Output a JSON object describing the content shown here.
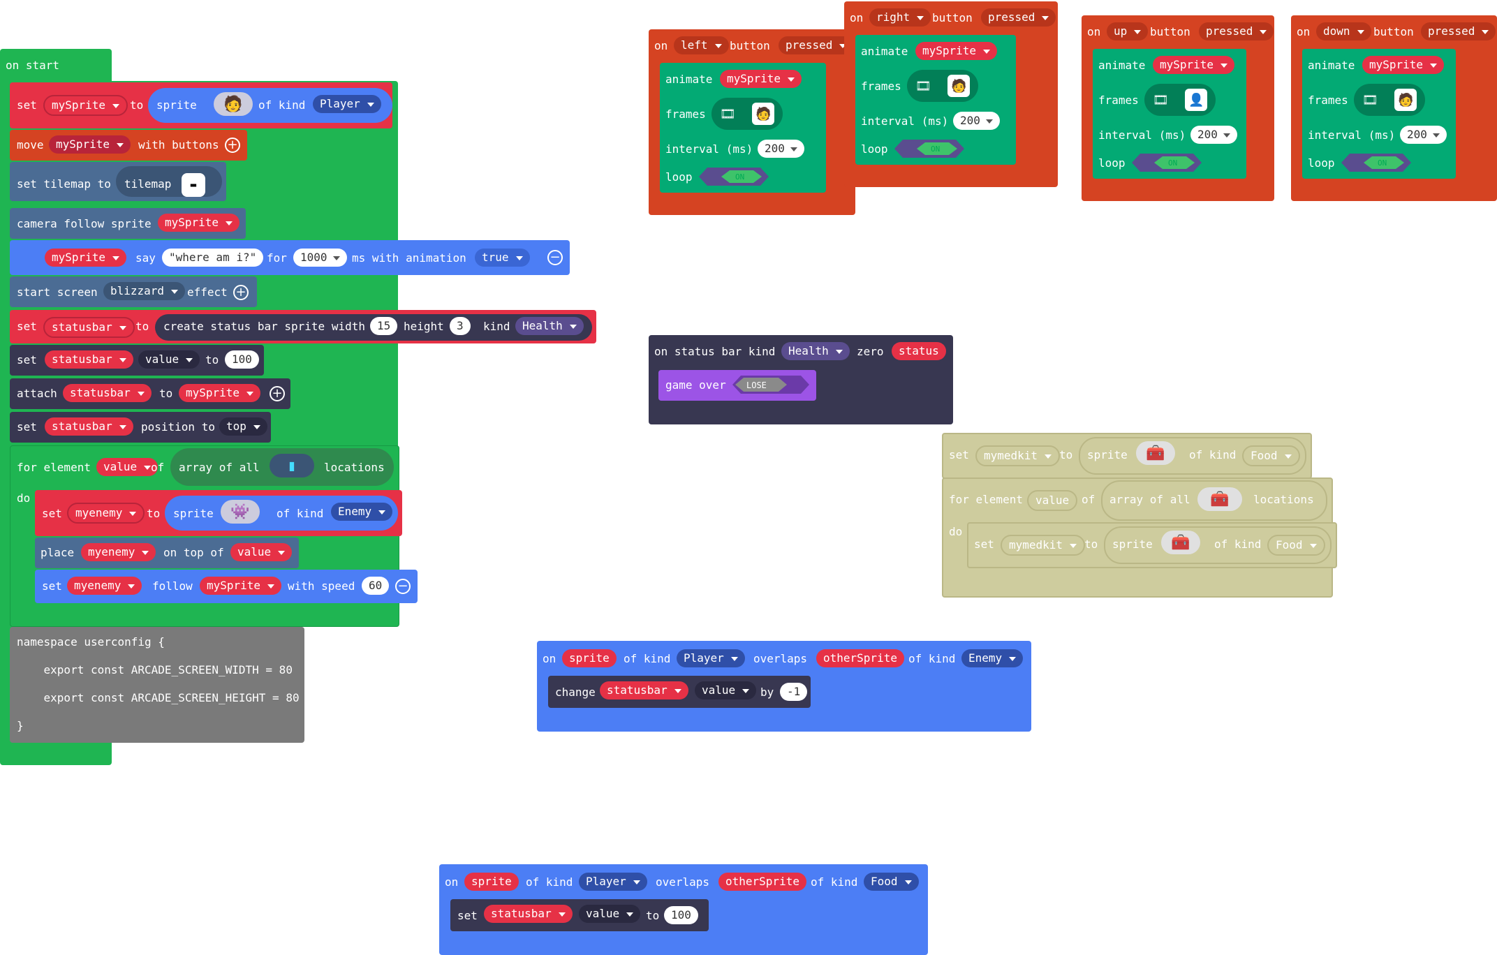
{
  "colors": {
    "event_green": "#1fb552",
    "sprite_red": "#e63146",
    "controller_orange": "#d54322",
    "scene_blue": "#4b6c94",
    "say_blue": "#4c7ef5",
    "status_dark": "#383751",
    "animation_green": "#03aa74",
    "game_purple": "#9c54e6",
    "loop_purple": "#5a4d8f",
    "gray_code": "#7a7a7a",
    "disabled_tan": "#c9c794"
  },
  "on_start": {
    "hat": "on start",
    "set_sprite": {
      "set": "set",
      "var": "mySprite",
      "to": "to",
      "sprite": "sprite",
      "of_kind": "of kind",
      "kind": "Player",
      "icon": "player-sprite-icon"
    },
    "move": {
      "move": "move",
      "var": "mySprite",
      "with": "with buttons"
    },
    "tilemap": {
      "label": "set tilemap to",
      "tilemap": "tilemap"
    },
    "camera": {
      "label": "camera follow sprite",
      "var": "mySprite"
    },
    "say": {
      "var": "mySprite",
      "say": "say",
      "text": "\"where am i?\"",
      "for": "for",
      "ms_val": "1000",
      "ms": "ms with animation",
      "anim": "true"
    },
    "effect": {
      "start": "start screen",
      "effect_name": "blizzard",
      "effect": "effect"
    },
    "statusbar": {
      "set": "set",
      "var": "statusbar",
      "to": "to",
      "create": "create status bar sprite width",
      "width": "15",
      "height_lbl": "height",
      "height": "3",
      "kind_lbl": "kind",
      "kind": "Health"
    },
    "set_value": {
      "set": "set",
      "var": "statusbar",
      "prop": "value",
      "to": "to",
      "val": "100"
    },
    "attach": {
      "attach": "attach",
      "var": "statusbar",
      "to": "to",
      "target": "mySprite"
    },
    "position": {
      "set": "set",
      "var": "statusbar",
      "position": "position to",
      "where": "top"
    },
    "for_each": {
      "for": "for element",
      "var": "value",
      "of": "of",
      "array": "array of all",
      "locations": "locations",
      "do": "do"
    },
    "set_enemy": {
      "set": "set",
      "var": "myenemy",
      "to": "to",
      "sprite": "sprite",
      "of_kind": "of kind",
      "kind": "Enemy"
    },
    "place": {
      "place": "place",
      "var": "myenemy",
      "on_top": "on top of",
      "target": "value"
    },
    "follow": {
      "set": "set",
      "var": "myenemy",
      "follow": "follow",
      "target": "mySprite",
      "speed_lbl": "with speed",
      "speed": "60"
    },
    "code_lines": [
      "namespace userconfig {",
      "    export const ARCADE_SCREEN_WIDTH = 80",
      "    export const ARCADE_SCREEN_HEIGHT = 80",
      "}"
    ]
  },
  "button_events": [
    {
      "on": "on",
      "button": "left",
      "button_lbl": "button",
      "action": "pressed",
      "animate": "animate",
      "var": "mySprite",
      "frames": "frames",
      "interval": "interval (ms)",
      "interval_val": "200",
      "loop": "loop",
      "loop_val": "ON"
    },
    {
      "on": "on",
      "button": "right",
      "button_lbl": "button",
      "action": "pressed",
      "animate": "animate",
      "var": "mySprite",
      "frames": "frames",
      "interval": "interval (ms)",
      "interval_val": "200",
      "loop": "loop",
      "loop_val": "ON"
    },
    {
      "on": "on",
      "button": "up",
      "button_lbl": "button",
      "action": "pressed",
      "animate": "animate",
      "var": "mySprite",
      "frames": "frames",
      "interval": "interval (ms)",
      "interval_val": "200",
      "loop": "loop",
      "loop_val": "ON"
    },
    {
      "on": "on",
      "button": "down",
      "button_lbl": "button",
      "action": "pressed",
      "animate": "animate",
      "var": "mySprite",
      "frames": "frames",
      "interval": "interval (ms)",
      "interval_val": "200",
      "loop": "loop",
      "loop_val": "ON"
    }
  ],
  "status_zero": {
    "label": "on status bar kind",
    "kind": "Health",
    "zero": "zero",
    "var": "status",
    "game_over": "game over",
    "lose": "LOSE"
  },
  "medkit": {
    "set": "set",
    "var": "mymedkit",
    "to": "to",
    "sprite": "sprite",
    "of_kind": "of kind",
    "kind": "Food",
    "for": "for element",
    "loop_var": "value",
    "of": "of",
    "array": "array of all",
    "locations": "locations",
    "do": "do"
  },
  "overlap_enemy": {
    "on": "on",
    "sprite": "sprite",
    "of_kind": "of kind",
    "kind1": "Player",
    "overlaps": "overlaps",
    "other": "otherSprite",
    "of_kind2": "of kind",
    "kind2": "Enemy",
    "change": "change",
    "var": "statusbar",
    "prop": "value",
    "by": "by",
    "amount": "-1"
  },
  "overlap_food": {
    "on": "on",
    "sprite": "sprite",
    "of_kind": "of kind",
    "kind1": "Player",
    "overlaps": "overlaps",
    "other": "otherSprite",
    "of_kind2": "of kind",
    "kind2": "Food",
    "set": "set",
    "var": "statusbar",
    "prop": "value",
    "to": "to",
    "val": "100"
  }
}
